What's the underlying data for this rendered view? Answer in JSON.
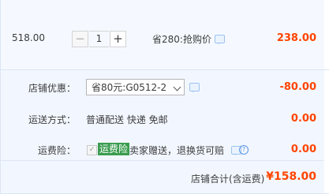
{
  "item": {
    "unit_price": "518.00",
    "quantity": "1",
    "minus": "−",
    "plus": "+",
    "promo_text": "省280:抢购价",
    "subtotal": "238.00"
  },
  "shop": {
    "discount_label": "店铺优惠：",
    "discount_select": "省80元:G0512-2",
    "discount_value": "-80.00",
    "shipping_label": "运送方式：",
    "shipping_text": "普通配送 快递 免邮",
    "shipping_value": "0.00",
    "insurance_label": "运费险：",
    "insurance_tag": "运费险",
    "insurance_desc": "卖家赠送，退换货可赔",
    "insurance_value": "0.00",
    "total_label": "店铺合计(含运费)",
    "total_value": "¥158.00"
  },
  "colors": {
    "price_red": "#ff4400",
    "tag_green": "#3a9c4f",
    "link_blue": "#5b95e3"
  }
}
